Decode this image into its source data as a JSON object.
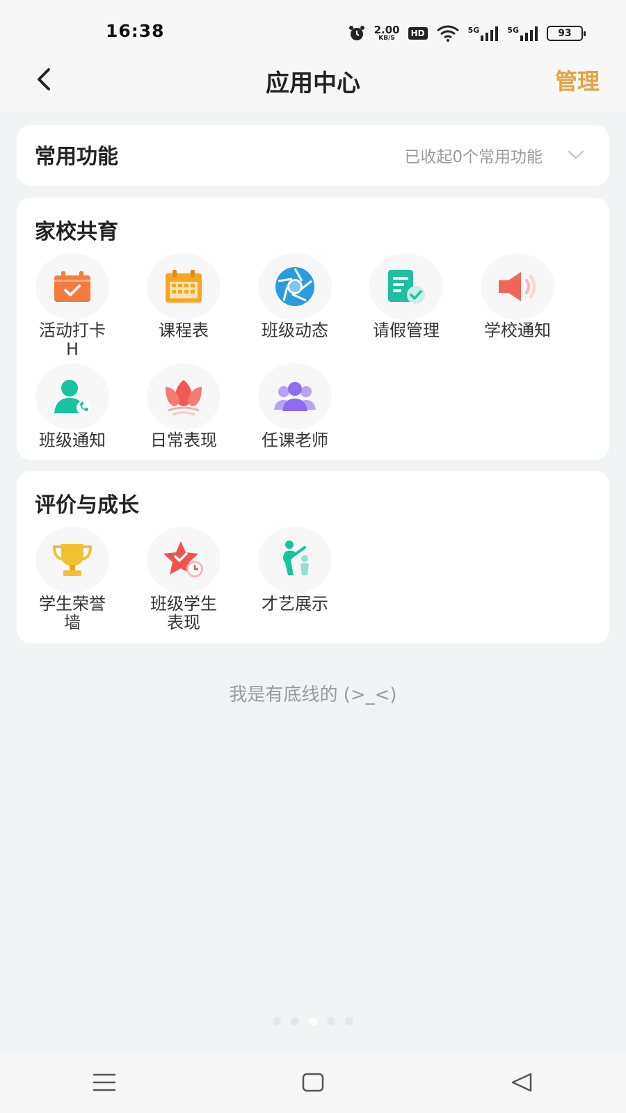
{
  "status": {
    "time": "16:38",
    "net_speed": "2.00",
    "net_unit": "KB/S",
    "hd": "HD",
    "signal1": "5G",
    "signal2": "5G",
    "battery": "93"
  },
  "header": {
    "title": "应用中心",
    "manage": "管理",
    "accent_color": "#e8a33d"
  },
  "common": {
    "title": "常用功能",
    "collapse_text": "已收起0个常用功能"
  },
  "home_school": {
    "title": "家校共育",
    "items": [
      {
        "label": "活动打卡\nH",
        "icon": "calendar-check-icon"
      },
      {
        "label": "课程表",
        "icon": "schedule-icon"
      },
      {
        "label": "班级动态",
        "icon": "aperture-icon"
      },
      {
        "label": "请假管理",
        "icon": "leave-doc-icon"
      },
      {
        "label": "学校通知",
        "icon": "megaphone-icon"
      },
      {
        "label": "班级通知",
        "icon": "contact-phone-icon"
      },
      {
        "label": "日常表现",
        "icon": "lotus-icon"
      },
      {
        "label": "任课老师",
        "icon": "teachers-group-icon"
      }
    ]
  },
  "growth": {
    "title": "评价与成长",
    "items": [
      {
        "label": "学生荣誉\n墙",
        "icon": "trophy-icon"
      },
      {
        "label": "班级学生\n表现",
        "icon": "star-clock-icon"
      },
      {
        "label": "才艺展示",
        "icon": "talent-icon"
      }
    ]
  },
  "footer_text": "我是有底线的 (>_<)"
}
